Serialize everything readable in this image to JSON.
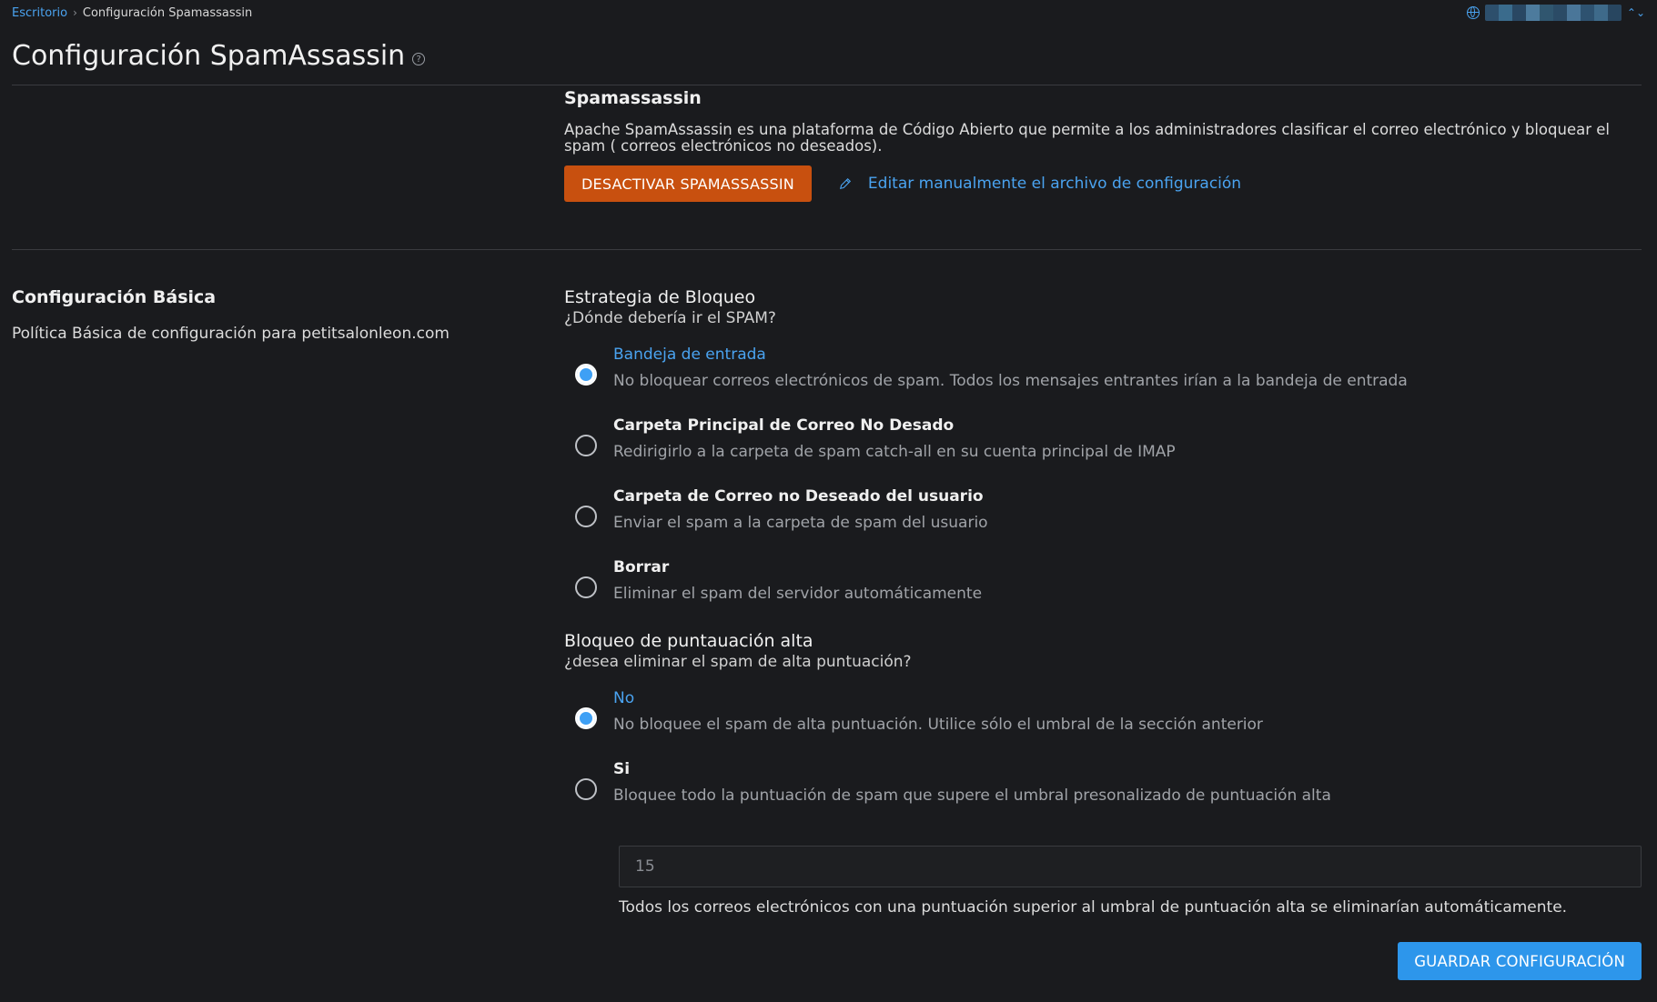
{
  "breadcrumb": {
    "home": "Escritorio",
    "separator": "›",
    "current": "Configuración Spamassassin"
  },
  "account": {
    "chevron": "⌃⌄",
    "globe_icon": "globe-icon"
  },
  "page": {
    "title": "Configuración SpamAssassin",
    "help_glyph": "?"
  },
  "spamassassin": {
    "title": "Spamassassin",
    "description": "Apache SpamAssassin es una plataforma de Código Abierto que permite a los administradores clasificar el correo electrónico y bloquear el spam ( correos electrónicos no deseados).",
    "deactivate_label": "DESACTIVAR SPAMASSASSIN",
    "edit_config_label": "Editar manualmente el archivo de configuración"
  },
  "basic": {
    "title": "Configuración Básica",
    "description": "Política Básica de configuración para petitsalonleon.com"
  },
  "blocking_strategy": {
    "title": "Estrategia de Bloqueo",
    "subtitle": "¿Dónde debería ir el SPAM?",
    "selected": 0,
    "options": [
      {
        "label": "Bandeja de entrada",
        "description": "No bloquear correos electrónicos de spam. Todos los mensajes entrantes irían a la bandeja de entrada"
      },
      {
        "label": "Carpeta Principal de Correo No Desado",
        "description": "Redirigirlo a la carpeta de spam catch-all en su cuenta principal de IMAP"
      },
      {
        "label": "Carpeta de Correo no Deseado del usuario",
        "description": "Enviar el spam a la carpeta de spam del usuario"
      },
      {
        "label": "Borrar",
        "description": "Eliminar el spam del servidor automáticamente"
      }
    ]
  },
  "high_score": {
    "title": "Bloqueo de puntauación alta",
    "subtitle": "¿desea eliminar el spam de alta puntuación?",
    "selected": 0,
    "options": [
      {
        "label": "No",
        "description": "No bloquee el spam de alta puntuación. Utilice sólo el umbral de la sección anterior"
      },
      {
        "label": "Si",
        "description": "Bloquee todo la puntuación de spam que supere el umbral presonalizado de puntuación alta"
      }
    ],
    "threshold_placeholder": "15",
    "threshold_value": "",
    "help": "Todos los correos electrónicos con una puntuación superior al umbral de puntuación alta se eliminarían automáticamente."
  },
  "save_label": "GUARDAR CONFIGURACIÓN",
  "colors": {
    "accent": "#2d96eb",
    "danger": "#c8500f",
    "link": "#4aa3f0"
  }
}
